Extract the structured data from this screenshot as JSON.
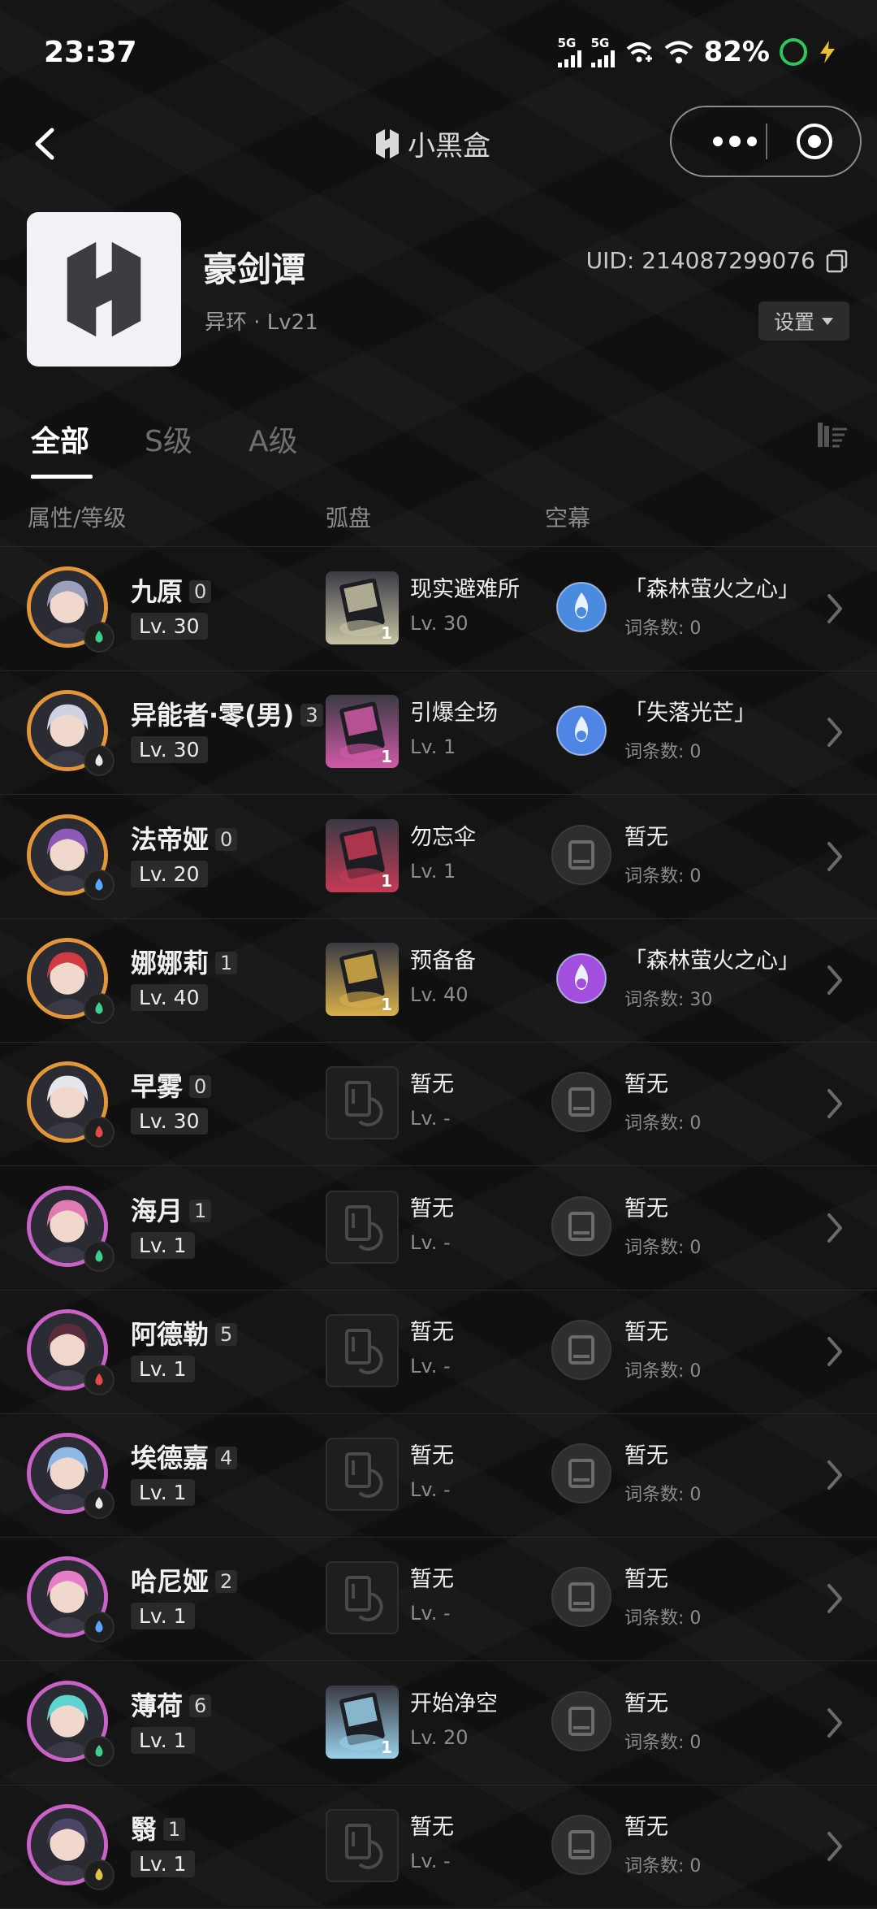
{
  "status_bar": {
    "time": "23:37",
    "battery": "82%",
    "net1": "5G",
    "net2": "5G"
  },
  "nav": {
    "brand": "小黑盒"
  },
  "profile": {
    "name": "豪剑谭",
    "sub": "异环 · Lv21",
    "uid": "UID: 214087299076",
    "settings": "设置"
  },
  "tabs": [
    "全部",
    "S级",
    "A级"
  ],
  "headers": {
    "attr": "属性/等级",
    "arc": "弧盘",
    "sky": "空幕"
  },
  "rows": [
    {
      "name": "九原",
      "cons": "0",
      "lv": "Lv. 30",
      "rank": "S",
      "element": "green",
      "face": "#9c9fb9",
      "weapon": "现实避难所",
      "wlv": "Lv. 30",
      "wcount": "1",
      "wcolor": "#c7c3a4",
      "sky": "「森林萤火之心」",
      "skycnt": "词条数: 0",
      "skycolor": "#4a8be0"
    },
    {
      "name": "异能者·零(男)",
      "cons": "3",
      "lv": "Lv. 30",
      "rank": "S",
      "element": "white",
      "face": "#cfd0e1",
      "weapon": "引爆全场",
      "wlv": "Lv. 1",
      "wcount": "1",
      "wcolor": "#d15aa8",
      "sky": "「失落光芒」",
      "skycnt": "词条数: 0",
      "skycolor": "#4f86e6"
    },
    {
      "name": "法帝娅",
      "cons": "0",
      "lv": "Lv. 20",
      "rank": "S",
      "element": "blue",
      "face": "#8d5ab8",
      "weapon": "勿忘伞",
      "wlv": "Lv. 1",
      "wcount": "1",
      "wcolor": "#c53a55",
      "sky": "暂无",
      "skycnt": "词条数: 0",
      "skycolor": ""
    },
    {
      "name": "娜娜莉",
      "cons": "1",
      "lv": "Lv. 40",
      "rank": "S",
      "element": "green",
      "face": "#cf3b42",
      "weapon": "预备备",
      "wlv": "Lv. 40",
      "wcount": "1",
      "wcolor": "#d8b04a",
      "sky": "「森林萤火之心」",
      "skycnt": "词条数: 30",
      "skycolor": "#a24fe0"
    },
    {
      "name": "早雾",
      "cons": "0",
      "lv": "Lv. 30",
      "rank": "S",
      "element": "red",
      "face": "#e6e6ee",
      "weapon": "暂无",
      "wlv": "Lv. -",
      "wcount": "",
      "wcolor": "",
      "sky": "暂无",
      "skycnt": "词条数: 0",
      "skycolor": ""
    },
    {
      "name": "海月",
      "cons": "1",
      "lv": "Lv. 1",
      "rank": "A",
      "element": "green",
      "face": "#e07ab2",
      "weapon": "暂无",
      "wlv": "Lv. -",
      "wcount": "",
      "wcolor": "",
      "sky": "暂无",
      "skycnt": "词条数: 0",
      "skycolor": ""
    },
    {
      "name": "阿德勒",
      "cons": "5",
      "lv": "Lv. 1",
      "rank": "A",
      "element": "red",
      "face": "#5a2b3a",
      "weapon": "暂无",
      "wlv": "Lv. -",
      "wcount": "",
      "wcolor": "",
      "sky": "暂无",
      "skycnt": "词条数: 0",
      "skycolor": ""
    },
    {
      "name": "埃德嘉",
      "cons": "4",
      "lv": "Lv. 1",
      "rank": "A",
      "element": "white",
      "face": "#8fb8e6",
      "weapon": "暂无",
      "wlv": "Lv. -",
      "wcount": "",
      "wcolor": "",
      "sky": "暂无",
      "skycnt": "词条数: 0",
      "skycolor": ""
    },
    {
      "name": "哈尼娅",
      "cons": "2",
      "lv": "Lv. 1",
      "rank": "A",
      "element": "blue",
      "face": "#e47fc7",
      "weapon": "暂无",
      "wlv": "Lv. -",
      "wcount": "",
      "wcolor": "",
      "sky": "暂无",
      "skycnt": "词条数: 0",
      "skycolor": ""
    },
    {
      "name": "薄荷",
      "cons": "6",
      "lv": "Lv. 1",
      "rank": "A",
      "element": "green",
      "face": "#5ed4d1",
      "weapon": "开始净空",
      "wlv": "Lv. 20",
      "wcount": "1",
      "wcolor": "#9ad0ea",
      "sky": "暂无",
      "skycnt": "词条数: 0",
      "skycolor": ""
    },
    {
      "name": "翳",
      "cons": "1",
      "lv": "Lv. 1",
      "rank": "A",
      "element": "gold",
      "face": "#4b4566",
      "weapon": "暂无",
      "wlv": "Lv. -",
      "wcount": "",
      "wcolor": "",
      "sky": "暂无",
      "skycnt": "词条数: 0",
      "skycolor": ""
    }
  ]
}
